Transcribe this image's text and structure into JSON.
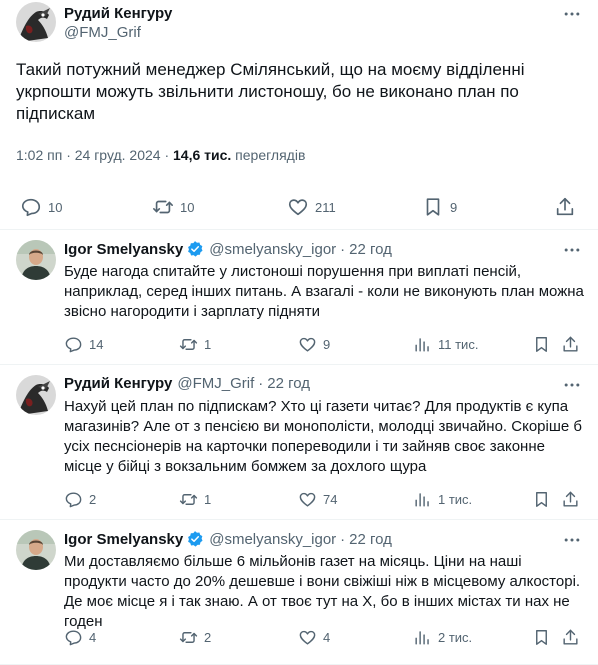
{
  "main_tweet": {
    "author_name": "Рудий Кенгуру",
    "author_handle": "@FMJ_Grif",
    "text": "Такий потужний менеджер Смілянський, що на моєму відділенні укрпошти можуть звільнити листоношу, бо не виконано план по підпискам",
    "time": "1:02 пп · 24 груд. 2024 · ",
    "views_count": "14,6 тис.",
    "views_label": " переглядів",
    "replies": "10",
    "reposts": "10",
    "likes": "211",
    "bookmarks": "9"
  },
  "replies": [
    {
      "author_name": "Igor Smelyansky",
      "author_handle": "@smelyansky_igor",
      "time": "22 год",
      "text": "Буде нагода спитайте у листоноші порушення при виплаті пенсій, наприклад, серед інших питань. А взагалі - коли не виконують план можна звісно нагородити і зарплату підняти",
      "replies": "14",
      "reposts": "1",
      "likes": "9",
      "views": "11 тис."
    },
    {
      "author_name": "Рудий Кенгуру",
      "author_handle": "@FMJ_Grif",
      "time": "22 год",
      "text": "Нахуй цей план по підпискам? Хто ці газети читає? Для продуктів є купа магазинів? Але от з пенсією ви монополісти, молодці звичайно. Скоріше б усіх песнсіонерів на карточки попереводили і ти зайняв своє законне місце у бійці з вокзальним бомжем за дохлого щура",
      "replies": "2",
      "reposts": "1",
      "likes": "74",
      "views": "1 тис."
    },
    {
      "author_name": "Igor Smelyansky",
      "author_handle": "@smelyansky_igor",
      "time": "22 год",
      "text": "Ми доставляємо більше 6 мільйонів газет на місяць. Ціни на наші продукти часто до 20% дешевше і вони свіжіші ніж в місцевому алкосторі. Де моє місце я і так знаю. А от твоє тут на Х, бо в інших містах ти нах не годен",
      "replies": "4",
      "reposts": "2",
      "likes": "4",
      "views": "2 тис."
    }
  ],
  "colors": {
    "text": "#0f1419",
    "secondary": "#536471",
    "verified": "#1d9bf0",
    "divider": "#eff3f4"
  },
  "icons": [
    "more-icon",
    "reply-icon",
    "repost-icon",
    "like-icon",
    "bookmark-icon",
    "share-icon",
    "views-icon",
    "verified-badge-icon"
  ]
}
